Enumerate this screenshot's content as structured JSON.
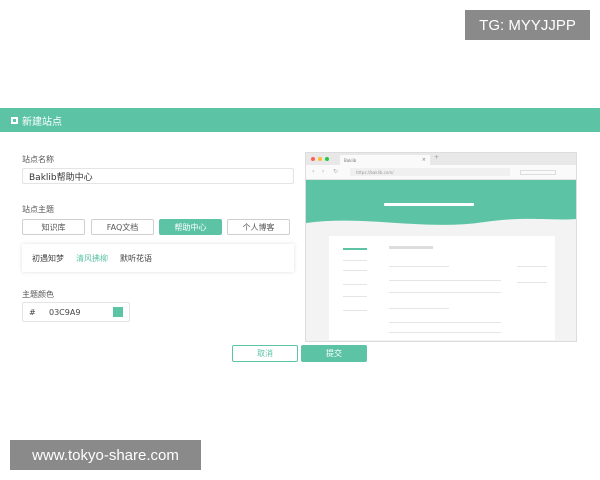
{
  "watermarks": {
    "top_right": "TG: MYYJJPP",
    "bottom_left": "www.tokyo-share.com"
  },
  "dialog": {
    "title": "新建站点",
    "site_name": {
      "label": "站点名称",
      "value": "Baklib帮助中心"
    },
    "site_theme": {
      "label": "站点主题",
      "tabs": [
        {
          "label": "知识库",
          "active": false
        },
        {
          "label": "FAQ文档",
          "active": false
        },
        {
          "label": "帮助中心",
          "active": true
        },
        {
          "label": "个人博客",
          "active": false
        }
      ],
      "styles": [
        {
          "label": "初遇知梦",
          "selected": false
        },
        {
          "label": "清风拂柳",
          "selected": true
        },
        {
          "label": "默听花语",
          "selected": false
        }
      ]
    },
    "theme_color": {
      "label": "主题颜色",
      "hash": "#",
      "value": "03C9A9",
      "swatch": "#5cc4a5"
    },
    "buttons": {
      "cancel": "取消",
      "submit": "提交"
    }
  },
  "preview": {
    "tab_title": "Baklib",
    "url": "https://baklib.com/",
    "dots": [
      "#ff5f57",
      "#febc2e",
      "#28c840"
    ]
  },
  "colors": {
    "accent": "#5cc4a5"
  }
}
